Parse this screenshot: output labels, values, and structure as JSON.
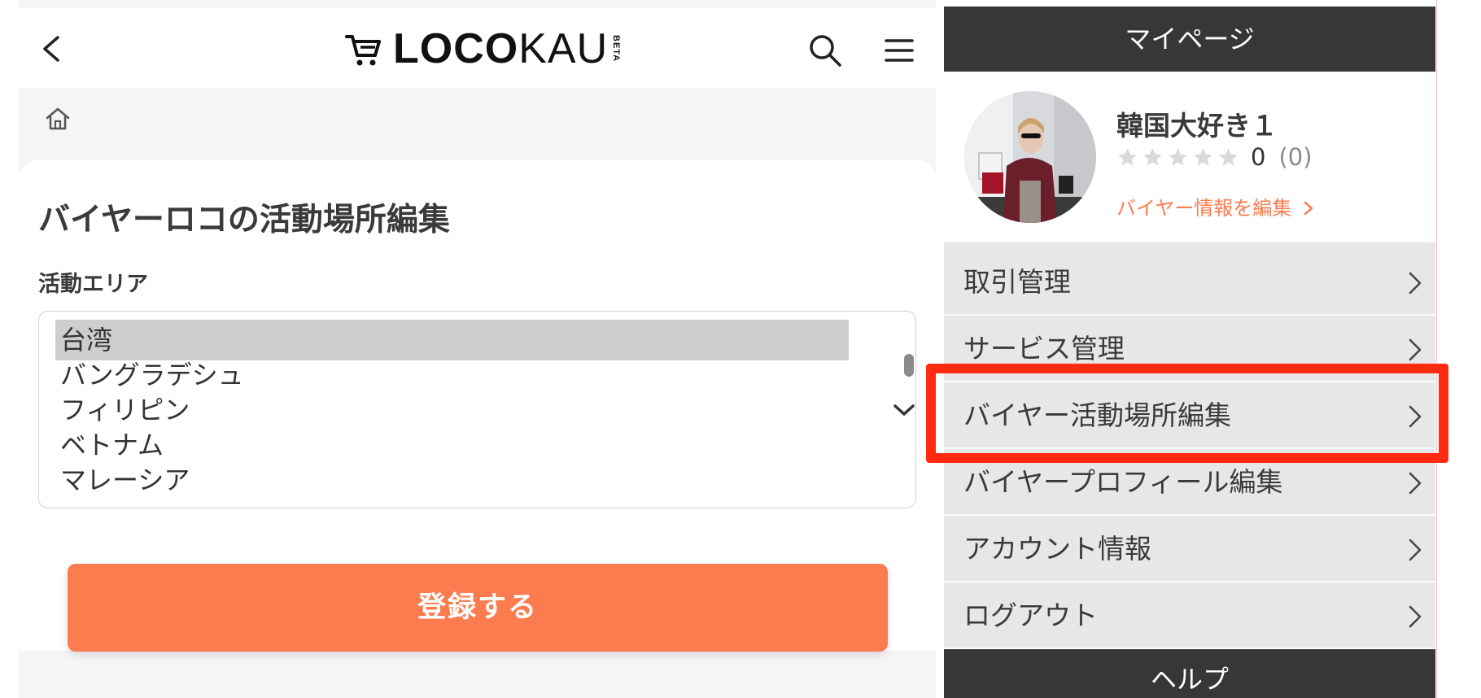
{
  "header": {
    "logo_bold": "LOCO",
    "logo_light": "KAU",
    "logo_beta": "BETA",
    "back_icon": "chevron-left-icon",
    "search_icon": "search-icon",
    "menu_icon": "hamburger-menu-icon"
  },
  "breadcrumb": {
    "home_icon": "home-icon"
  },
  "form": {
    "title": "バイヤーロコの活動場所編集",
    "area_label": "活動エリア",
    "options": [
      "台湾",
      "バングラデシュ",
      "フィリピン",
      "ベトナム",
      "マレーシア"
    ],
    "selected": "台湾",
    "submit_label": "登録する"
  },
  "sidebar": {
    "header": "マイページ",
    "profile": {
      "name": "韓国大好き１",
      "rating": "0",
      "review_count": "(0)",
      "stars_filled": 0,
      "stars_total": 5,
      "edit_link": "バイヤー情報を編集"
    },
    "items": [
      {
        "label": "取引管理"
      },
      {
        "label": "サービス管理"
      },
      {
        "label": "バイヤー活動場所編集"
      },
      {
        "label": "バイヤープロフィール編集"
      },
      {
        "label": "アカウント情報"
      },
      {
        "label": "ログアウト"
      }
    ],
    "help": "ヘルプ"
  },
  "colors": {
    "accent": "#fd7c4f",
    "highlight": "#ff2a10",
    "panel_dark": "#373737",
    "panel_bg": "#e7e7ea"
  }
}
